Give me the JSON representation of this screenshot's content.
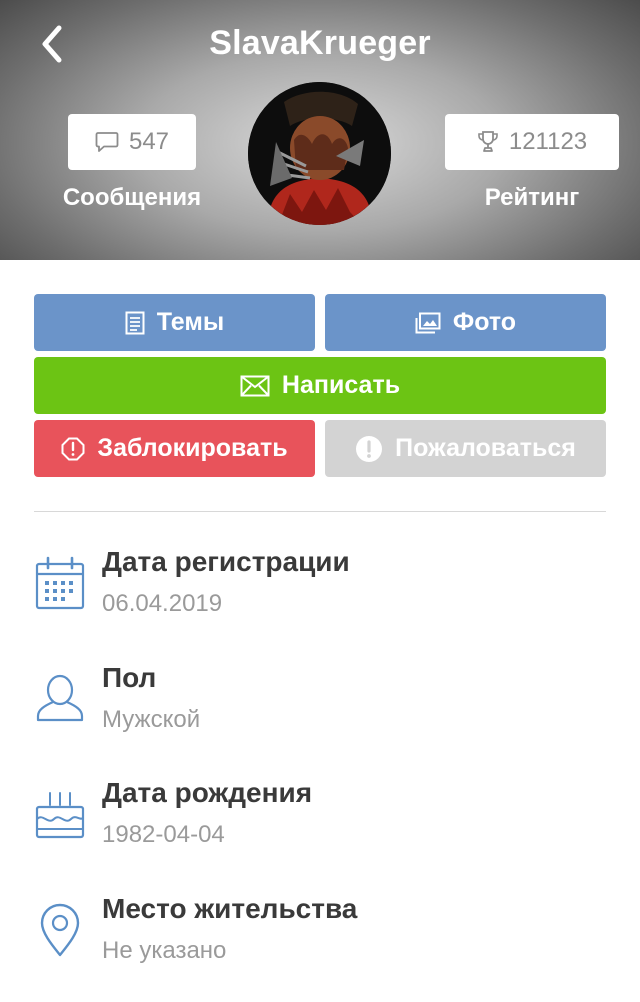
{
  "header": {
    "title": "SlavaKrueger",
    "messages_count": "547",
    "messages_label": "Сообщения",
    "rating_value": "121123",
    "rating_label": "Рейтинг"
  },
  "actions": {
    "topics": "Темы",
    "photo": "Фото",
    "write": "Написать",
    "block": "Заблокировать",
    "report": "Пожаловаться"
  },
  "colors": {
    "blue": "#6b94c9",
    "green": "#6cc414",
    "red": "#e8535b",
    "grey": "#d3d3d3",
    "icon_blue": "#5b8fc7"
  },
  "info": [
    {
      "icon": "calendar-icon",
      "title": "Дата регистрации",
      "value": "06.04.2019"
    },
    {
      "icon": "user-icon",
      "title": "Пол",
      "value": "Мужской"
    },
    {
      "icon": "cake-icon",
      "title": "Дата рождения",
      "value": "1982-04-04"
    },
    {
      "icon": "location-pin-icon",
      "title": "Место жительства",
      "value": "Не указано"
    }
  ]
}
